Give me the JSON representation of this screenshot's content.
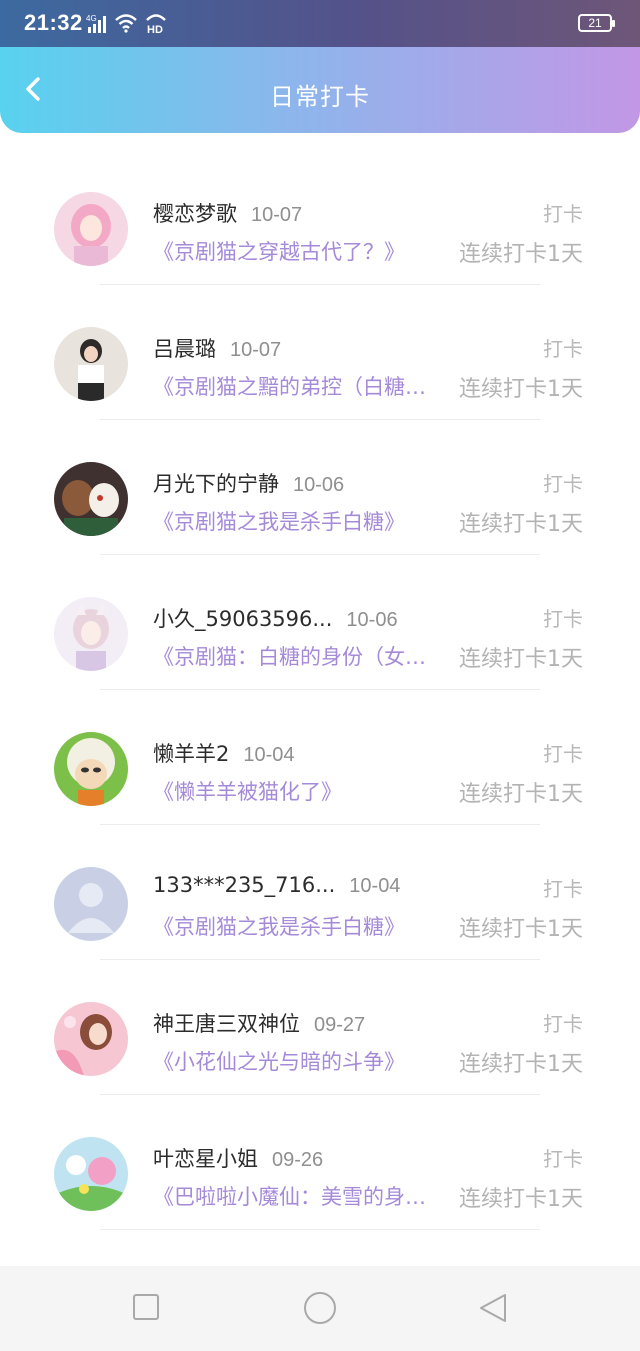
{
  "status": {
    "time": "21:32",
    "signal_label": "4G",
    "hd_label": "HD",
    "battery": "21"
  },
  "header": {
    "title": "日常打卡",
    "back_icon": "chevron-left-icon"
  },
  "colors": {
    "gradient_start": "#58d2ee",
    "gradient_end": "#c297e6",
    "book_title": "#a58ad8",
    "muted": "#b3b3b3"
  },
  "items": [
    {
      "name": "樱恋梦歌",
      "date": "10-07",
      "tag": "打卡",
      "book": "《京剧猫之穿越古代了？》",
      "streak": "连续打卡1天"
    },
    {
      "name": "吕晨璐",
      "date": "10-07",
      "tag": "打卡",
      "book": "《京剧猫之黯的弟控（白糖…",
      "streak": "连续打卡1天"
    },
    {
      "name": "月光下的宁静",
      "date": "10-06",
      "tag": "打卡",
      "book": "《京剧猫之我是杀手白糖》",
      "streak": "连续打卡1天"
    },
    {
      "name": "小久_59063596...",
      "date": "10-06",
      "tag": "打卡",
      "book": "《京剧猫：白糖的身份（女…",
      "streak": "连续打卡1天"
    },
    {
      "name": "懒羊羊2",
      "date": "10-04",
      "tag": "打卡",
      "book": "《懒羊羊被猫化了》",
      "streak": "连续打卡1天"
    },
    {
      "name": "133***235_716...",
      "date": "10-04",
      "tag": "打卡",
      "book": "《京剧猫之我是杀手白糖》",
      "streak": "连续打卡1天"
    },
    {
      "name": "神王唐三双神位",
      "date": "09-27",
      "tag": "打卡",
      "book": "《小花仙之光与暗的斗争》",
      "streak": "连续打卡1天"
    },
    {
      "name": "叶恋星小姐",
      "date": "09-26",
      "tag": "打卡",
      "book": "《巴啦啦小魔仙：美雪的身…",
      "streak": "连续打卡1天"
    }
  ],
  "navbar": {
    "icons": [
      "recent-apps-icon",
      "home-icon",
      "back-triangle-icon"
    ]
  }
}
